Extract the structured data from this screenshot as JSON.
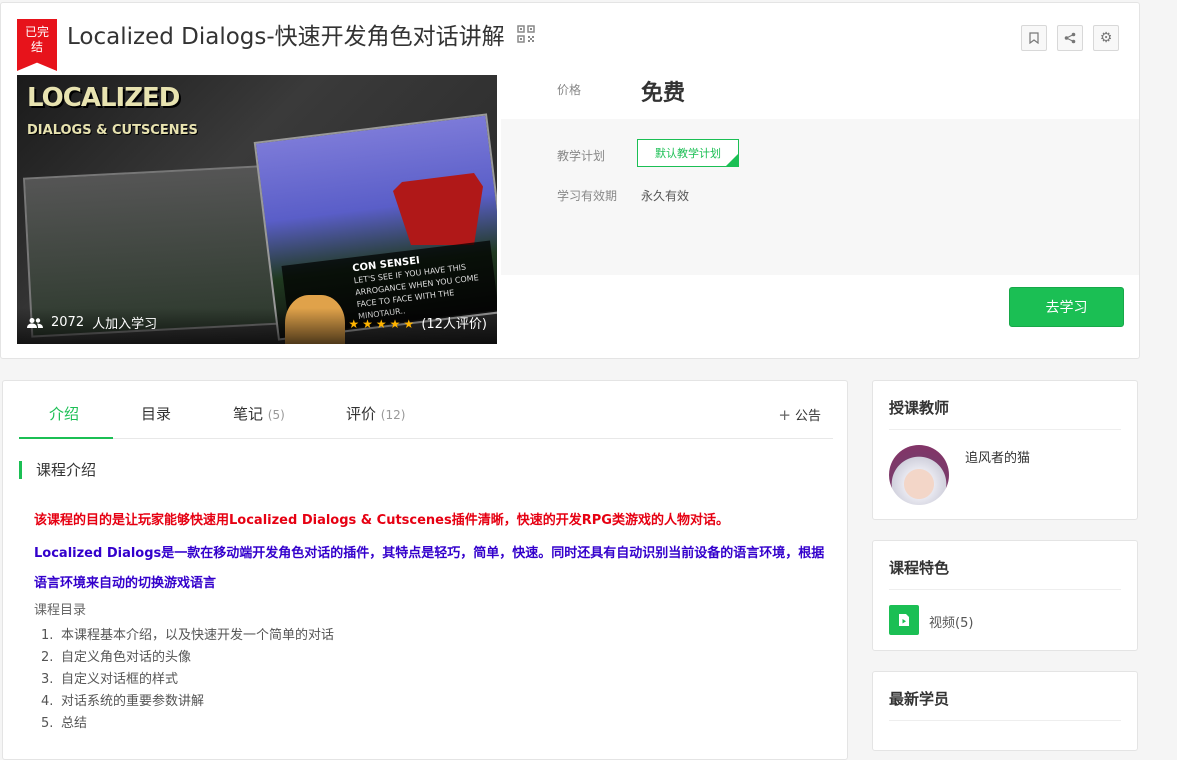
{
  "course": {
    "badge": "已完结",
    "badge_line1": "已完",
    "badge_line2": "结",
    "title": "Localized Dialogs-快速开发角色对话讲解",
    "cover": {
      "logo_line1": "LOCALIZED",
      "logo_line2": "DIALOGS & CUTSCENES",
      "dialog_speaker": "CON SENSEI",
      "dialog_text": "LET'S SEE IF YOU HAVE THIS ARROGANCE WHEN YOU COME FACE TO FACE WITH THE MINOTAUR.."
    },
    "students_count": "2072",
    "students_label": "人加入学习",
    "rating_stars": 5,
    "rating_text": "(12人评价)",
    "price_label": "价格",
    "price_value": "免费",
    "plan_label": "教学计划",
    "plan_value": "默认教学计划",
    "validity_label": "学习有效期",
    "validity_value": "永久有效",
    "learn_button": "去学习",
    "icons": [
      "qrcode-icon",
      "bookmark-icon",
      "share-icon",
      "gear-icon",
      "users-icon",
      "star-icon"
    ]
  },
  "tabs": [
    {
      "label": "介绍",
      "count": ""
    },
    {
      "label": "目录",
      "count": ""
    },
    {
      "label": "笔记",
      "count": "(5)"
    },
    {
      "label": "评价",
      "count": "(12)"
    }
  ],
  "announcement": "公告",
  "intro": {
    "section_title": "课程介绍",
    "red_text": "该课程的目的是让玩家能够快速用Localized Dialogs & Cutscenes插件清晰，快速的开发RPG类游戏的人物对话。",
    "blue_text": "Localized Dialogs是一款在移动端开发角色对话的插件，其特点是轻巧，简单，快速。同时还具有自动识别当前设备的语言环境，根据语言环境来自动的切换游戏语言",
    "toc_title": "课程目录",
    "toc": [
      {
        "n": "1.",
        "text": "本课程基本介绍，以及快速开发一个简单的对话"
      },
      {
        "n": "2.",
        "text": "自定义角色对话的头像"
      },
      {
        "n": "3.",
        "text": "自定义对话框的样式"
      },
      {
        "n": "4.",
        "text": "对话系统的重要参数讲解"
      },
      {
        "n": "5.",
        "text": "总结"
      }
    ]
  },
  "sidebar": {
    "teacher_title": "授课教师",
    "teacher_name": "追风者的猫",
    "features_title": "课程特色",
    "feature_label": "视频(5)",
    "students_title": "最新学员"
  },
  "colors": {
    "accent": "#1bbf54",
    "badge": "#e7131b",
    "red_text": "#e60012",
    "blue_text": "#3300cc"
  }
}
